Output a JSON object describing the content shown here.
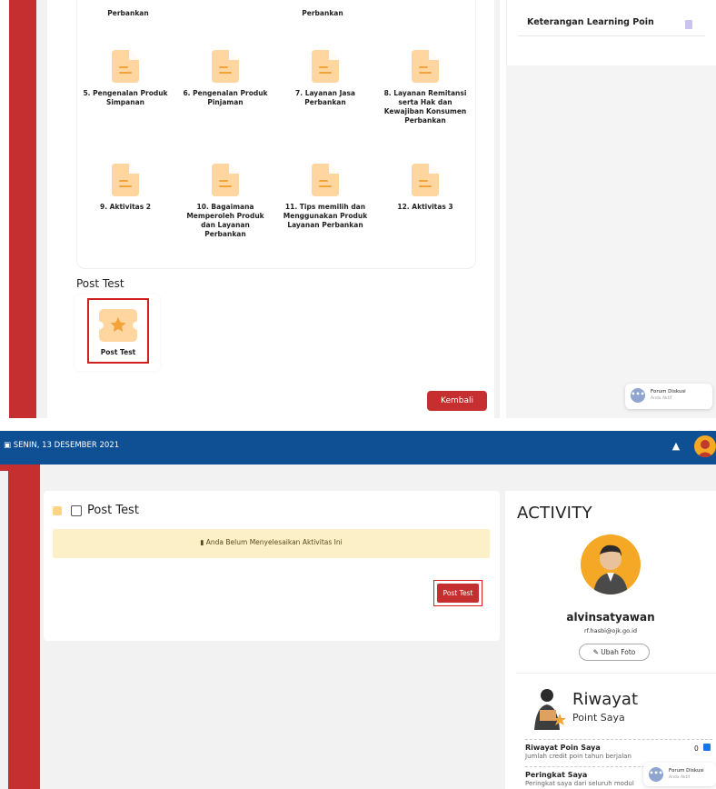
{
  "top": {
    "partial_labels": [
      "Perbankan",
      "Perbankan"
    ],
    "modules": [
      {
        "label": "5. Pengenalan Produk Simpanan"
      },
      {
        "label": "6. Pengenalan Produk Pinjaman"
      },
      {
        "label": "7. Layanan Jasa Perbankan"
      },
      {
        "label": "8. Layanan Remitansi serta Hak dan Kewajiban Konsumen Perbankan"
      },
      {
        "label": "9. Aktivitas 2"
      },
      {
        "label": "10. Bagaimana Memperoleh Produk dan Layanan Perbankan"
      },
      {
        "label": "11. Tips memilih dan Menggunakan Produk Layanan Perbankan"
      },
      {
        "label": "12. Aktivitas 3"
      }
    ],
    "post_test_section": "Post Test",
    "post_test_tile_label": "Post Test",
    "kembali_label": "Kembali",
    "keterangan_label": "Keterangan Learning Poin",
    "forum": {
      "title": "Forum Diskusi",
      "subtitle": "Anda Aktif"
    }
  },
  "bottom": {
    "date": "SENIN, 13 DESEMBER 2021",
    "page_title": "Post Test",
    "alert": "Anda Belum Menyelesaikan Aktivitas Ini",
    "post_test_button": "Post Test",
    "activity_heading": "ACTIVITY",
    "username": "alvinsatyawan",
    "email": "rf.hasbi@ojk.go.id",
    "ubah_foto": "Ubah Foto",
    "riwayat_title": "Riwayat",
    "riwayat_subtitle": "Point Saya",
    "riwayat_poin": {
      "title": "Riwayat Poin Saya",
      "desc": "Jumlah credit poin tahun berjalan",
      "value": "0"
    },
    "peringkat": {
      "title": "Peringkat Saya",
      "desc": "Peringkat saya dari seluruh modul"
    },
    "forum": {
      "title": "Forum Diskusi",
      "subtitle": "Anda Aktif"
    }
  },
  "colors": {
    "accent_red": "#c62f2f",
    "navbar_blue": "#0f4f94",
    "doc_icon": "#ffd6a0",
    "alert_bg": "#fbf0c7"
  }
}
